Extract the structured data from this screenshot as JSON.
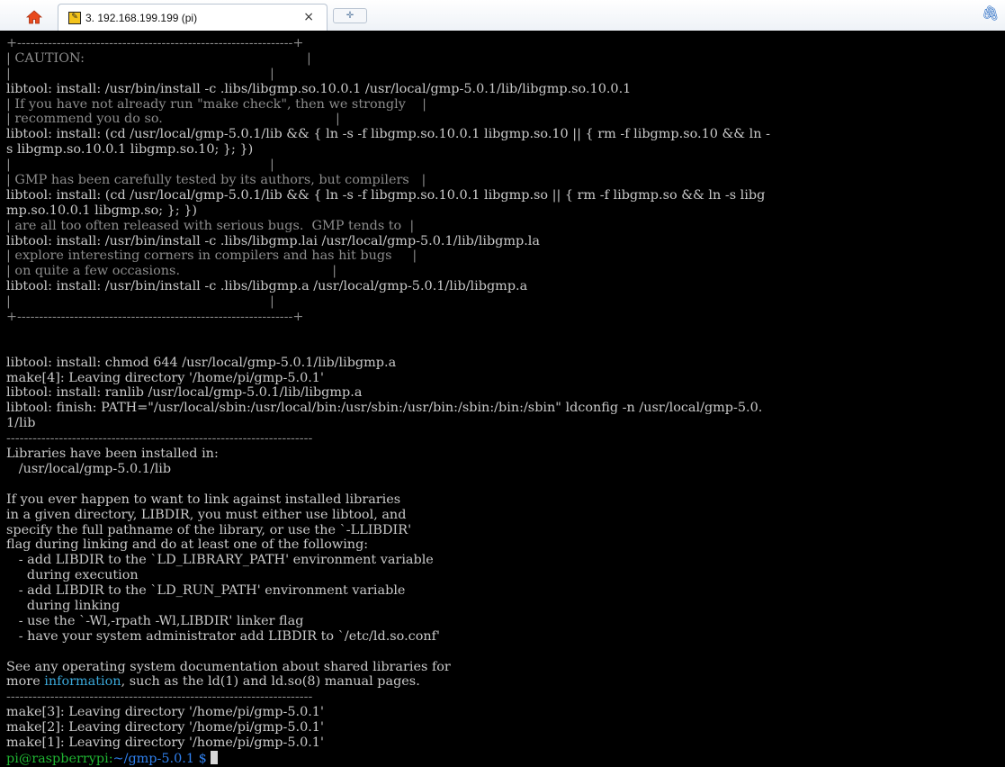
{
  "tabs": {
    "home_icon": "home-icon",
    "active_title": "3. 192.168.199.199 (pi)",
    "close_glyph": "×",
    "new_tab_glyph": "✛",
    "attach_icon": "paperclip-icon"
  },
  "terminal": {
    "lines": [
      "+---------------------------------------------------------------+",
      "| CAUTION:                                                      |",
      "|                                                               |",
      "libtool: install: /usr/bin/install -c .libs/libgmp.so.10.0.1 /usr/local/gmp-5.0.1/lib/libgmp.so.10.0.1",
      "| If you have not already run \"make check\", then we strongly    |",
      "| recommend you do so.                                          |",
      "libtool: install: (cd /usr/local/gmp-5.0.1/lib && { ln -s -f libgmp.so.10.0.1 libgmp.so.10 || { rm -f libgmp.so.10 && ln -",
      "s libgmp.so.10.0.1 libgmp.so.10; }; })",
      "|                                                               |",
      "| GMP has been carefully tested by its authors, but compilers   |",
      "libtool: install: (cd /usr/local/gmp-5.0.1/lib && { ln -s -f libgmp.so.10.0.1 libgmp.so || { rm -f libgmp.so && ln -s libg",
      "mp.so.10.0.1 libgmp.so; }; })",
      "| are all too often released with serious bugs.  GMP tends to  |",
      "libtool: install: /usr/bin/install -c .libs/libgmp.lai /usr/local/gmp-5.0.1/lib/libgmp.la",
      "| explore interesting corners in compilers and has hit bugs     |",
      "| on quite a few occasions.                                     |",
      "libtool: install: /usr/bin/install -c .libs/libgmp.a /usr/local/gmp-5.0.1/lib/libgmp.a",
      "|                                                               |",
      "+---------------------------------------------------------------+",
      "",
      "",
      "libtool: install: chmod 644 /usr/local/gmp-5.0.1/lib/libgmp.a",
      "make[4]: Leaving directory '/home/pi/gmp-5.0.1'",
      "libtool: install: ranlib /usr/local/gmp-5.0.1/lib/libgmp.a",
      "libtool: finish: PATH=\"/usr/local/sbin:/usr/local/bin:/usr/sbin:/usr/bin:/sbin:/bin:/sbin\" ldconfig -n /usr/local/gmp-5.0.",
      "1/lib",
      "----------------------------------------------------------------------",
      "Libraries have been installed in:",
      "   /usr/local/gmp-5.0.1/lib",
      "",
      "If you ever happen to want to link against installed libraries",
      "in a given directory, LIBDIR, you must either use libtool, and",
      "specify the full pathname of the library, or use the `-LLIBDIR'",
      "flag during linking and do at least one of the following:",
      "   - add LIBDIR to the `LD_LIBRARY_PATH' environment variable",
      "     during execution",
      "   - add LIBDIR to the `LD_RUN_PATH' environment variable",
      "     during linking",
      "   - use the `-Wl,-rpath -Wl,LIBDIR' linker flag",
      "   - have your system administrator add LIBDIR to `/etc/ld.so.conf'",
      "",
      "See any operating system documentation about shared libraries for"
    ],
    "info_line": {
      "before": "more ",
      "link": "information",
      "after": ", such as the ld(1) and ld.so(8) manual pages."
    },
    "trailing_lines": [
      "----------------------------------------------------------------------",
      "make[3]: Leaving directory '/home/pi/gmp-5.0.1'",
      "make[2]: Leaving directory '/home/pi/gmp-5.0.1'",
      "make[1]: Leaving directory '/home/pi/gmp-5.0.1'"
    ],
    "prompt": {
      "user_host": "pi@raspberrypi:",
      "path": "~/gmp-5.0.1 $",
      "trailing_space": " "
    }
  },
  "colors": {
    "terminal_bg": "#000000",
    "text": "#c9c9c9",
    "link": "#3aa7d8",
    "prompt_user": "#1fb532",
    "prompt_path": "#2f80ee"
  }
}
